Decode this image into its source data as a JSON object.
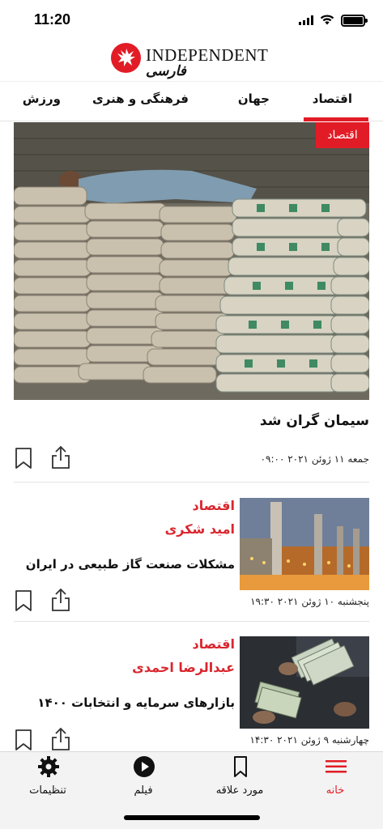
{
  "status_bar": {
    "time": "11:20"
  },
  "brand": {
    "name": "INDEPENDENT",
    "subtitle": "فارسی",
    "accent_color": "#e21c26"
  },
  "tabs": [
    {
      "label": "اقتصاد",
      "active": true
    },
    {
      "label": "جهان",
      "active": false
    },
    {
      "label": "فرهنگی و هنری",
      "active": false
    },
    {
      "label": "ورزش",
      "active": false
    }
  ],
  "featured": {
    "category": "اقتصاد",
    "title": "سیمان گران شد",
    "date": "جمعه ۱۱ ژوئن ۲۰۲۱ ۰۹:۰۰"
  },
  "articles": [
    {
      "category": "اقتصاد",
      "author": "امید شکری",
      "title": "مشکلات صنعت گاز طبیعی در ایران",
      "date": "پنجشنبه ۱۰ ژوئن ۲۰۲۱ ۱۹:۳۰"
    },
    {
      "category": "اقتصاد",
      "author": "عبدالرضا احمدی",
      "title": "بازارهای سرمایه و انتخابات ۱۴۰۰",
      "date": "چهارشنبه ۹ ژوئن ۲۰۲۱ ۱۴:۳۰"
    }
  ],
  "icons": {
    "bookmark": "bookmark-icon",
    "share": "share-icon"
  },
  "bottom_nav": [
    {
      "label": "خانه",
      "icon": "menu-icon",
      "active": true
    },
    {
      "label": "مورد علاقه",
      "icon": "bookmark-icon",
      "active": false
    },
    {
      "label": "فیلم",
      "icon": "play-icon",
      "active": false
    },
    {
      "label": "تنظیمات",
      "icon": "gear-icon",
      "active": false
    }
  ]
}
